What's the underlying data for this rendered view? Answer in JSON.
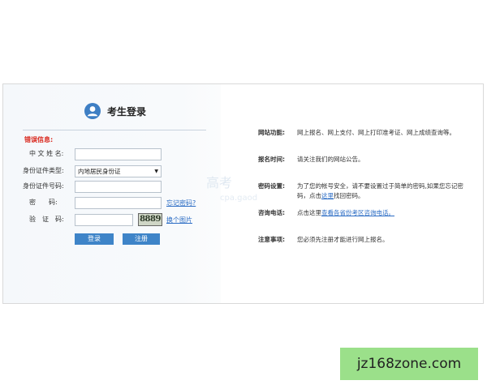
{
  "login": {
    "title": "考生登录",
    "error_label": "错误信息:",
    "fields": {
      "name_label": "中 文 姓 名:",
      "id_type_label": "身份证件类型:",
      "id_type_value": "内地居民身份证",
      "id_number_label": "身份证件号码:",
      "password_label": "密　　码:",
      "captcha_label": "验　证　码:"
    },
    "forgot_password": "忘记密码?",
    "change_image": "换个图片",
    "captcha_text": "8889",
    "login_button": "登录",
    "register_button": "注册"
  },
  "watermark": {
    "main": "高考",
    "sub": "cpa.gaod"
  },
  "info": {
    "items": [
      {
        "key": "网站功能:",
        "value": "网上报名、网上支付、网上打印准考证、网上成绩查询等。"
      },
      {
        "key": "报名时间:",
        "value": "请关注我们的网站公告。"
      },
      {
        "key": "密码设置:",
        "value_pre": "为了您的帐号安全，请不要设置过于简单的密码,如果您忘记密码，点击",
        "link": "这里",
        "value_post": "找回密码。"
      },
      {
        "key": "咨询电话:",
        "value_pre": "点击这里",
        "link": "查看各省份考区咨询电话。",
        "value_post": ""
      },
      {
        "key": "注意事项:",
        "value": "您必须先注册才能进行网上报名。"
      }
    ]
  },
  "site_badge": "jz168zone.com"
}
